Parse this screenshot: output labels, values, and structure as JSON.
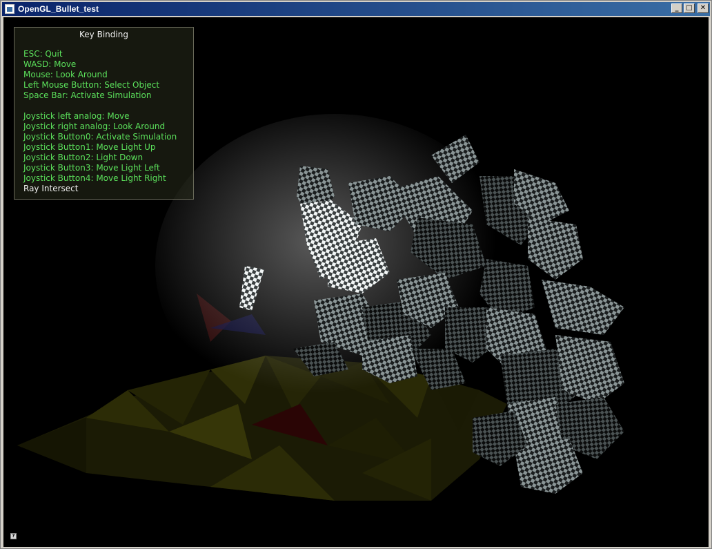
{
  "window": {
    "title": "OpenGL_Bullet_test",
    "minimize_glyph": "_",
    "maximize_glyph": "□",
    "close_glyph": "✕"
  },
  "help_panel": {
    "title": "Key Binding",
    "bindings": [
      "ESC: Quit",
      "WASD: Move",
      "Mouse: Look Around",
      "Left Mouse Button: Select Object",
      "Space Bar: Activate Simulation",
      "",
      "Joystick left analog: Move",
      "Joystick right analog: Look Around",
      "Joystick Button0: Activate Simulation",
      "Joystick Button1: Move Light Up",
      "Joystick Button2: Light Down",
      "Joystick Button3: Move Light Left",
      "Joystick Button4: Move Light Right"
    ],
    "status_line": "Ray Intersect"
  },
  "status_icon": "?"
}
